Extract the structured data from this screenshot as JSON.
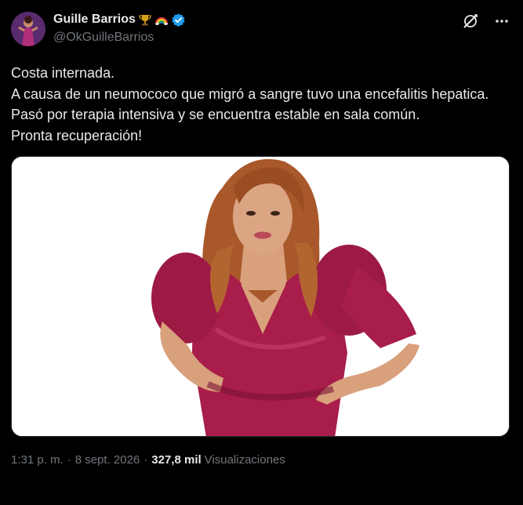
{
  "author": {
    "display_name": "Guille Barrios",
    "handle": "@OkGuilleBarrios",
    "badges": [
      "trophy-icon",
      "rainbow-icon",
      "verified-badge-icon"
    ]
  },
  "header_actions": [
    "grok-icon",
    "more-icon"
  ],
  "tweet": {
    "text": "Costa internada.\nA causa de un neumococo que migró a sangre tuvo una encefalitis hepatica. Pasó por terapia intensiva y se encuentra estable en sala común.\nPronta recuperación!"
  },
  "meta": {
    "time": "1:31 p. m.",
    "separator": "·",
    "date": "8 sept. 2026",
    "views_count": "327,8 mil",
    "views_label": "Visualizaciones"
  },
  "colors": {
    "background": "#000000",
    "text": "#e7e9ea",
    "secondary": "#71767b",
    "verified": "#1d9bf0",
    "dress": "#a81d4a"
  }
}
